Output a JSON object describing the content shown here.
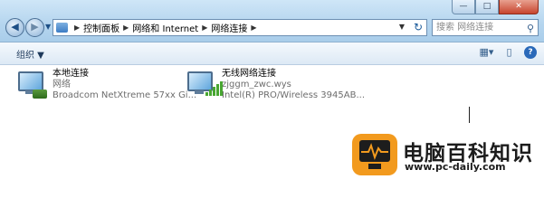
{
  "nav": {
    "back_glyph": "◀",
    "forward_glyph": "▶"
  },
  "address": {
    "crumbs": [
      "控制面板",
      "网络和 Internet",
      "网络连接"
    ],
    "separator": "▶"
  },
  "search": {
    "placeholder": "搜索 网络连接"
  },
  "window_buttons": {
    "minimize": "—",
    "maximize": "□",
    "close": "✕"
  },
  "toolbar": {
    "organize_label": "组织 ▼"
  },
  "connections": [
    {
      "name": "本地连接",
      "status": "网络",
      "device": "Broadcom NetXtreme 57xx Gi...",
      "icon": "wired-network-icon"
    },
    {
      "name": "无线网络连接",
      "status": "zjggm_zwc.wys",
      "device": "Intel(R) PRO/Wireless 3945AB...",
      "icon": "wireless-network-icon"
    }
  ],
  "watermark": {
    "title": "电脑百科知识",
    "url": "www.pc-daily.com"
  },
  "colors": {
    "chrome": "#b6d6ef",
    "watermark_orange": "#f29a1e",
    "signal_green": "#48a631"
  }
}
